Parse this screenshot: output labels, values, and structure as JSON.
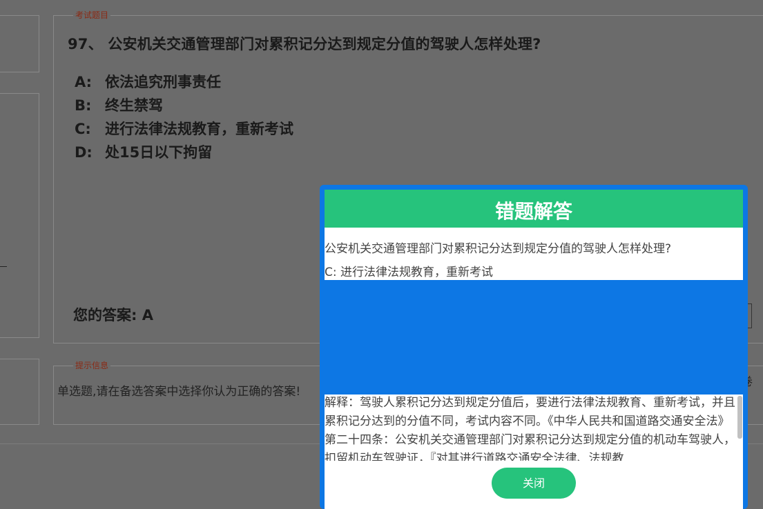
{
  "exam": {
    "legend": "考试题目",
    "question": "97、 公安机关交通管理部门对累积记分达到规定分值的驾驶人怎样处理?",
    "options": [
      {
        "letter": "A:",
        "text": "依法追究刑事责任"
      },
      {
        "letter": "B:",
        "text": "终生禁驾"
      },
      {
        "letter": "C:",
        "text": "进行法律法规教育，重新考试"
      },
      {
        "letter": "D:",
        "text": "处15日以下拘留"
      }
    ],
    "your_answer": "您的答案: A"
  },
  "hint": {
    "legend": "提示信息",
    "text": "单选题,请在备选答案中选择你认为正确的答案!",
    "right_text": "卷"
  },
  "modal": {
    "title": "错题解答",
    "question": "公安机关交通管理部门对累积记分达到规定分值的驾驶人怎样处理?",
    "answer": "C: 进行法律法规教育，重新考试",
    "explanation": "解释：驾驶人累积记分达到规定分值后，要进行法律法规教育、重新考试，并且累积记分达到的分值不同，考试内容不同。《中华人民共和国道路交通安全法》第二十四条：公安机关交通管理部门对累积记分达到规定分值的机动车驾驶人，扣留机动车驾驶证，『对其进行道路交通安全法律、法规教",
    "close_label": "关闭"
  }
}
